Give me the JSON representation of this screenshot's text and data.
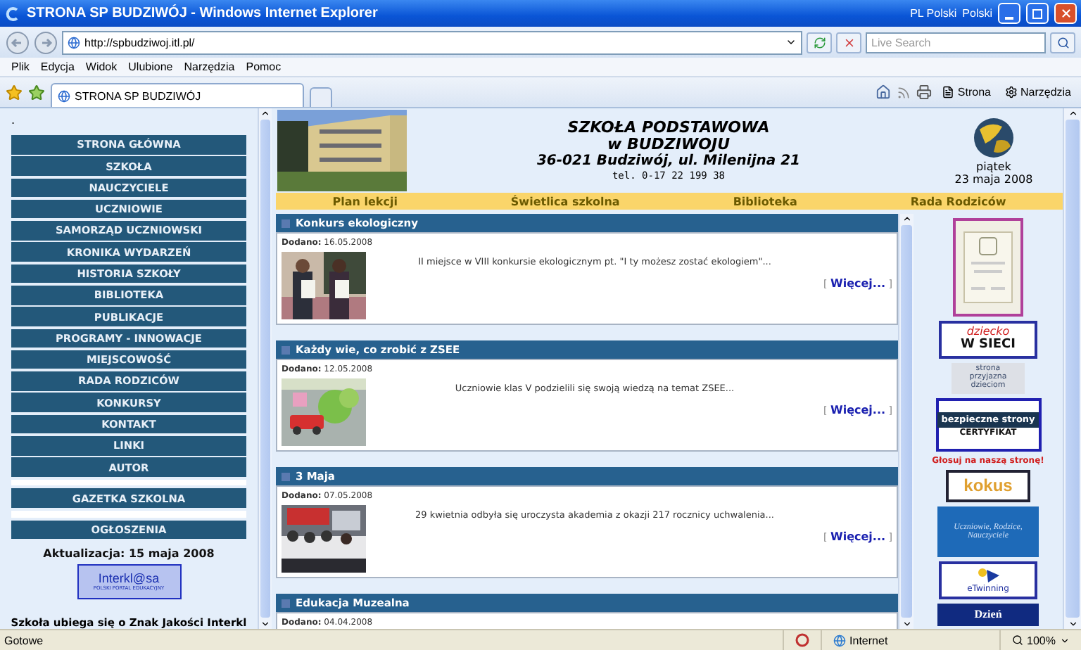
{
  "window": {
    "title": "STRONA SP BUDZIWÓJ - Windows Internet Explorer",
    "language_bar": [
      "PL Polski",
      "Polski"
    ]
  },
  "address_bar": {
    "url": "http://spbudziwoj.itl.pl/"
  },
  "search": {
    "placeholder": "Live Search"
  },
  "menu": [
    "Plik",
    "Edycja",
    "Widok",
    "Ulubione",
    "Narzędzia",
    "Pomoc"
  ],
  "tab": {
    "title": "STRONA SP BUDZIWÓJ",
    "selected": true
  },
  "command_bar": [
    "Strona",
    "Narzędzia"
  ],
  "sidebar": {
    "top_mark": ".",
    "items": [
      "STRONA GŁÓWNA",
      "SZKOŁA",
      "NAUCZYCIELE",
      "UCZNIOWIE",
      "SAMORZĄD UCZNIOWSKI",
      "KRONIKA WYDARZEŃ",
      "HISTORIA SZKOŁY",
      "BIBLIOTEKA",
      "PUBLIKACJE",
      "PROGRAMY - INNOWACJE",
      "MIEJSCOWOŚĆ",
      "RADA RODZICÓW",
      "KONKURSY",
      "KONTAKT",
      "LINKI",
      "AUTOR"
    ],
    "extra_items": [
      "GAZETKA SZKOLNA",
      "OGŁOSZENIA"
    ],
    "updated": "Aktualizacja: 15 maja 2008",
    "badge": {
      "brand": "Interkl@sa",
      "tagline": "POLSKI PORTAL EDUKACYJNY"
    },
    "note": "Szkoła ubiega się o Znak Jakości Interkl"
  },
  "header": {
    "school": [
      "SZKOŁA PODSTAWOWA",
      "w BUDZIWOJU"
    ],
    "address": "36-021 Budziwój, ul. Milenijna 21",
    "phone": "tel. 0-17 22 199 38",
    "day": "piątek",
    "date": "23 maja 2008"
  },
  "nav": [
    "Plan lekcji",
    "Świetlica szkolna",
    "Biblioteka",
    "Rada Rodziców"
  ],
  "news": [
    {
      "title": "Konkurs ekologiczny",
      "added_label": "Dodano:",
      "date": "16.05.2008",
      "text": "II miejsce w VIII konkursie ekologicznym pt. \"I ty możesz zostać ekologiem\"...",
      "more_open": "[",
      "more": "Więcej...",
      "more_close": "]",
      "kind": "picture"
    },
    {
      "title": "Każdy wie, co zrobić z ZSEE",
      "added_label": "Dodano:",
      "date": "12.05.2008",
      "text": "Uczniowie klas V podzielili się swoją wiedzą na temat ZSEE...",
      "more_open": "[",
      "more": "Więcej...",
      "more_close": "]",
      "kind": "picture"
    },
    {
      "title": "3 Maja",
      "added_label": "Dodano:",
      "date": "07.05.2008",
      "text": "29 kwietnia odbyła się uroczysta akademia z okazji 217 rocznicy uchwalenia...",
      "more_open": "[",
      "more": "Więcej...",
      "more_close": "]",
      "kind": "picture"
    },
    {
      "title": "Edukacja Muzealna",
      "added_label": "Dodano:",
      "date": "04.04.2008"
    }
  ],
  "banners": [
    {
      "kind": "certificate"
    },
    {
      "kind": "dziecko",
      "texts": [
        "dziecko",
        "W SIECI"
      ]
    },
    {
      "kind": "przyjazna",
      "texts": [
        "strona przyjazna dzieciom"
      ]
    },
    {
      "kind": "bezpieczne",
      "texts": [
        "bezpieczne strony",
        "CERTYFIKAT"
      ]
    },
    {
      "kind": "vote",
      "texts": [
        "Głosuj na naszą stronę!"
      ]
    },
    {
      "kind": "kokus",
      "texts": [
        "kokus"
      ]
    },
    {
      "kind": "uczniowie",
      "texts": [
        "Uczniowie, Rodzice, Nauczyciele"
      ]
    },
    {
      "kind": "etwinning",
      "texts": [
        "eTwinning"
      ]
    },
    {
      "kind": "dzien",
      "texts": [
        "Dzień"
      ]
    }
  ],
  "status_bar": {
    "text": "Gotowe",
    "zone": "Internet",
    "zoom": "100%"
  }
}
